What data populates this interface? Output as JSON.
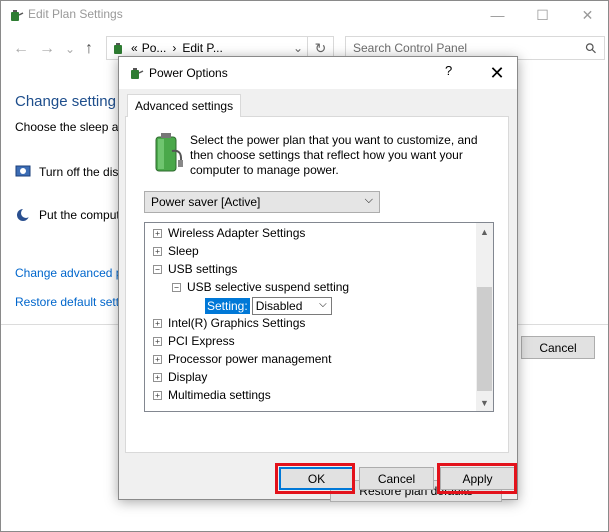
{
  "window": {
    "title": "Edit Plan Settings",
    "controls": {
      "minimize": "—",
      "maximize": "☐",
      "close": "✕"
    }
  },
  "nav": {
    "back": "←",
    "forward": "→",
    "recent": "⌄",
    "up": "↑",
    "breadcrumb": [
      "Po...",
      "Edit P..."
    ],
    "breadcrumb_prefix": "«",
    "breadcrumb_sep": "›",
    "dropdown": "⌄",
    "refresh": "↻",
    "search_placeholder": "Search Control Panel",
    "search_icon": "⚲"
  },
  "background_page": {
    "heading": "Change setting",
    "subtitle": "Choose the sleep an",
    "row_display": "Turn off the dis",
    "row_sleep": "Put the comput",
    "link_advanced": "Change advanced p",
    "link_restore": "Restore default setti",
    "cancel_label": "Cancel"
  },
  "dialog": {
    "title": "Power Options",
    "help": "?",
    "close": "✕",
    "tab_label": "Advanced settings",
    "description": "Select the power plan that you want to customize, and then choose settings that reflect how you want your computer to manage power.",
    "plan_selected": "Power saver [Active]",
    "tree": {
      "items": [
        {
          "label": "Wireless Adapter Settings",
          "expander": "+"
        },
        {
          "label": "Sleep",
          "expander": "+"
        },
        {
          "label": "USB settings",
          "expander": "−"
        },
        {
          "label": "USB selective suspend setting",
          "expander": "−"
        },
        {
          "label": "Intel(R) Graphics Settings",
          "expander": "+"
        },
        {
          "label": "PCI Express",
          "expander": "+"
        },
        {
          "label": "Processor power management",
          "expander": "+"
        },
        {
          "label": "Display",
          "expander": "+"
        },
        {
          "label": "Multimedia settings",
          "expander": "+"
        }
      ],
      "setting_label": "Setting:",
      "setting_value": "Disabled"
    },
    "restore_label": "Restore plan defaults",
    "ok_label": "OK",
    "cancel_label": "Cancel",
    "apply_label": "Apply"
  },
  "colors": {
    "highlight_box": "#e3121b",
    "selection": "#0078d7",
    "link": "#0066cc"
  }
}
